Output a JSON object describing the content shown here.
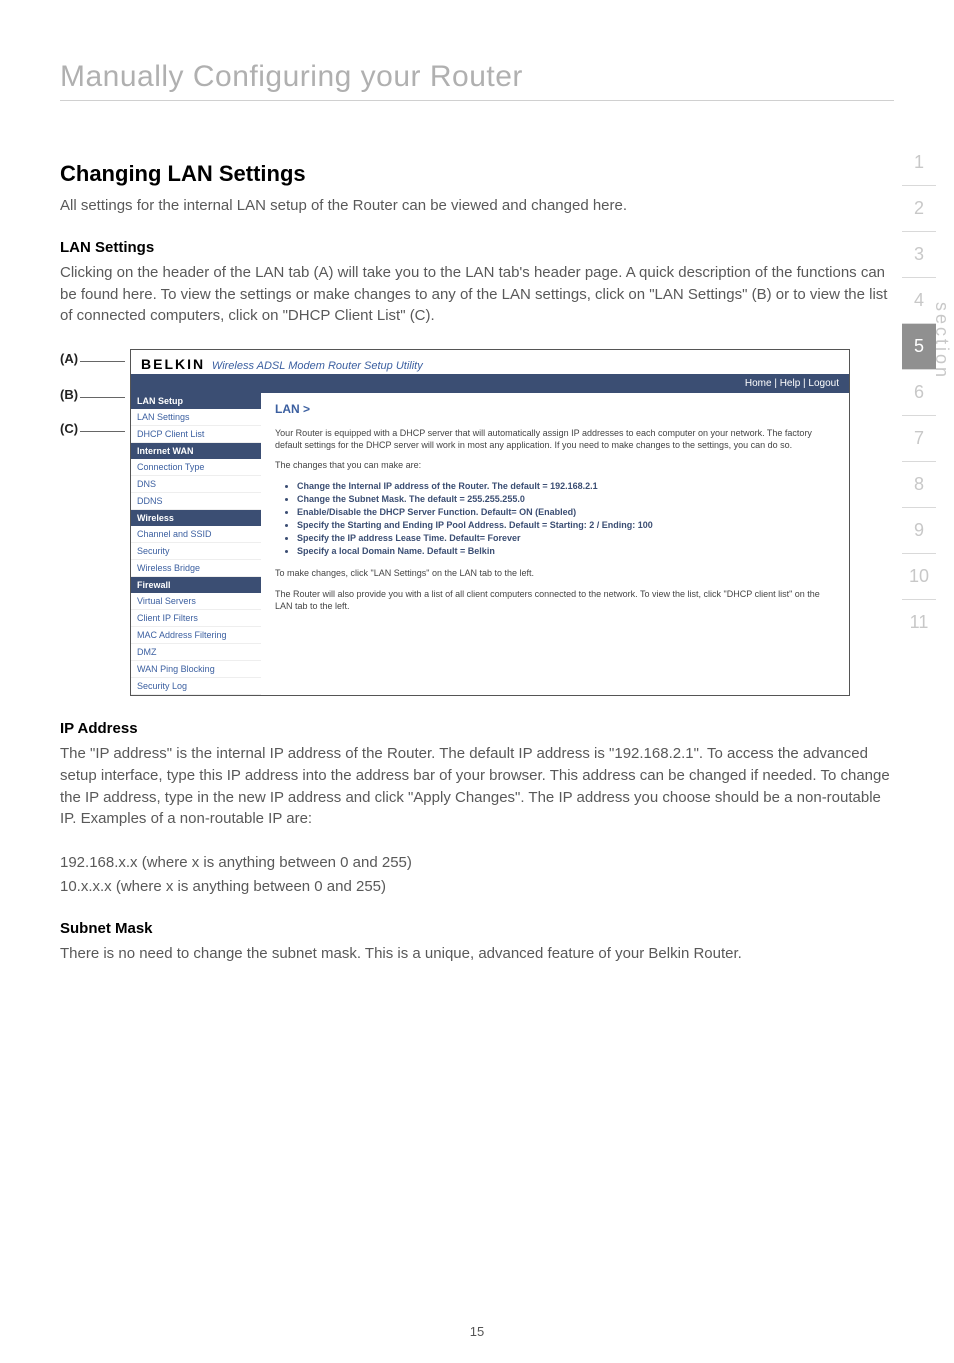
{
  "page": {
    "title": "Manually Configuring your Router",
    "number": "15"
  },
  "section_nav": {
    "items": [
      "1",
      "2",
      "3",
      "4",
      "5",
      "6",
      "7",
      "8",
      "9",
      "10",
      "11"
    ],
    "active_index": 4,
    "label": "section"
  },
  "content": {
    "h2": "Changing LAN Settings",
    "intro": "All settings for the internal LAN setup of the Router can be viewed and changed here.",
    "lan_settings": {
      "heading": "LAN Settings",
      "body": "Clicking on the header of the LAN tab (A) will take you to the LAN tab's header page. A quick description of the functions can be found here. To view the settings or make changes to any of the LAN settings, click on \"LAN Settings\" (B) or to view the list of connected computers, click on \"DHCP Client List\" (C)."
    },
    "figure_labels": {
      "a": "(A)",
      "b": "(B)",
      "c": "(C)"
    },
    "router": {
      "brand": "BELKIN",
      "subtitle": "Wireless ADSL Modem Router Setup Utility",
      "topbar": "Home | Help | Logout",
      "nav": {
        "groups": [
          {
            "header": "LAN Setup",
            "items": [
              "LAN Settings",
              "DHCP Client List"
            ]
          },
          {
            "header": "Internet WAN",
            "items": [
              "Connection Type",
              "DNS",
              "DDNS"
            ]
          },
          {
            "header": "Wireless",
            "items": [
              "Channel and SSID",
              "Security",
              "Wireless Bridge"
            ]
          },
          {
            "header": "Firewall",
            "items": [
              "Virtual Servers",
              "Client IP Filters",
              "MAC Address Filtering",
              "DMZ",
              "WAN Ping Blocking",
              "Security Log"
            ]
          }
        ]
      },
      "main": {
        "title": "LAN >",
        "p1": "Your Router is equipped with a DHCP server that will automatically assign IP addresses to each computer on your network. The factory default settings for the DHCP server will work in most any application. If you need to make changes to the settings, you can do so.",
        "p2": "The changes that you can make are:",
        "bullets": [
          "Change the Internal IP address of the Router. The default = 192.168.2.1",
          "Change the Subnet Mask. The default = 255.255.255.0",
          "Enable/Disable the DHCP Server Function. Default= ON (Enabled)",
          "Specify the Starting and Ending IP Pool Address. Default = Starting: 2 / Ending: 100",
          "Specify the IP address Lease Time. Default= Forever",
          "Specify a local Domain Name. Default = Belkin"
        ],
        "p3": "To make changes, click \"LAN Settings\" on the LAN tab to the left.",
        "p4": "The Router will also provide you with a list of all client computers connected to the network. To view the list, click \"DHCP client list\" on the LAN tab to the left."
      }
    },
    "ip_address": {
      "heading": "IP Address",
      "body": "The \"IP address\" is the internal IP address of the Router. The default IP address is \"192.168.2.1\". To access the advanced setup interface, type this IP address into the address bar of your browser. This address can be changed if needed. To change the IP address, type in the new IP address and click \"Apply Changes\". The IP address you choose should be a non-routable IP. Examples of a non-routable IP are:",
      "ex1": "192.168.x.x (where x is anything between 0 and 255)",
      "ex2": "10.x.x.x (where x is anything between 0 and 255)"
    },
    "subnet": {
      "heading": "Subnet Mask",
      "body": "There is no need to change the subnet mask. This is a unique, advanced feature of your Belkin Router."
    }
  }
}
